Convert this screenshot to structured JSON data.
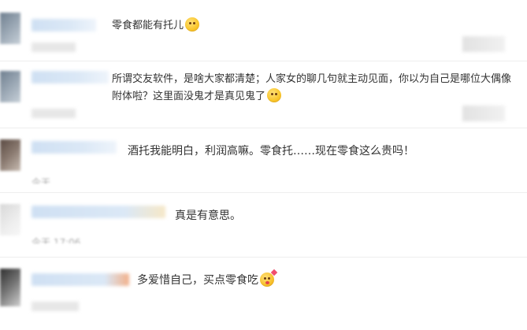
{
  "comments": [
    {
      "text": "零食都能有托儿",
      "emoji": "surprised-emoji"
    },
    {
      "text": "所谓交友软件，是啥大家都清楚；人家女的聊几句就主动见面，你以为自己是哪位大偶像附体啦？这里面没鬼才是真见鬼了",
      "emoji": "smirk-emoji"
    },
    {
      "text": "酒托我能明白，利润高嘛。零食托……现在零食这么贵吗！",
      "time": "今天"
    },
    {
      "text": "真是有意思。",
      "time": "今天 17:06"
    },
    {
      "text": "多爱惜自己，买点零食吃",
      "emoji": "kiss-emoji"
    }
  ]
}
